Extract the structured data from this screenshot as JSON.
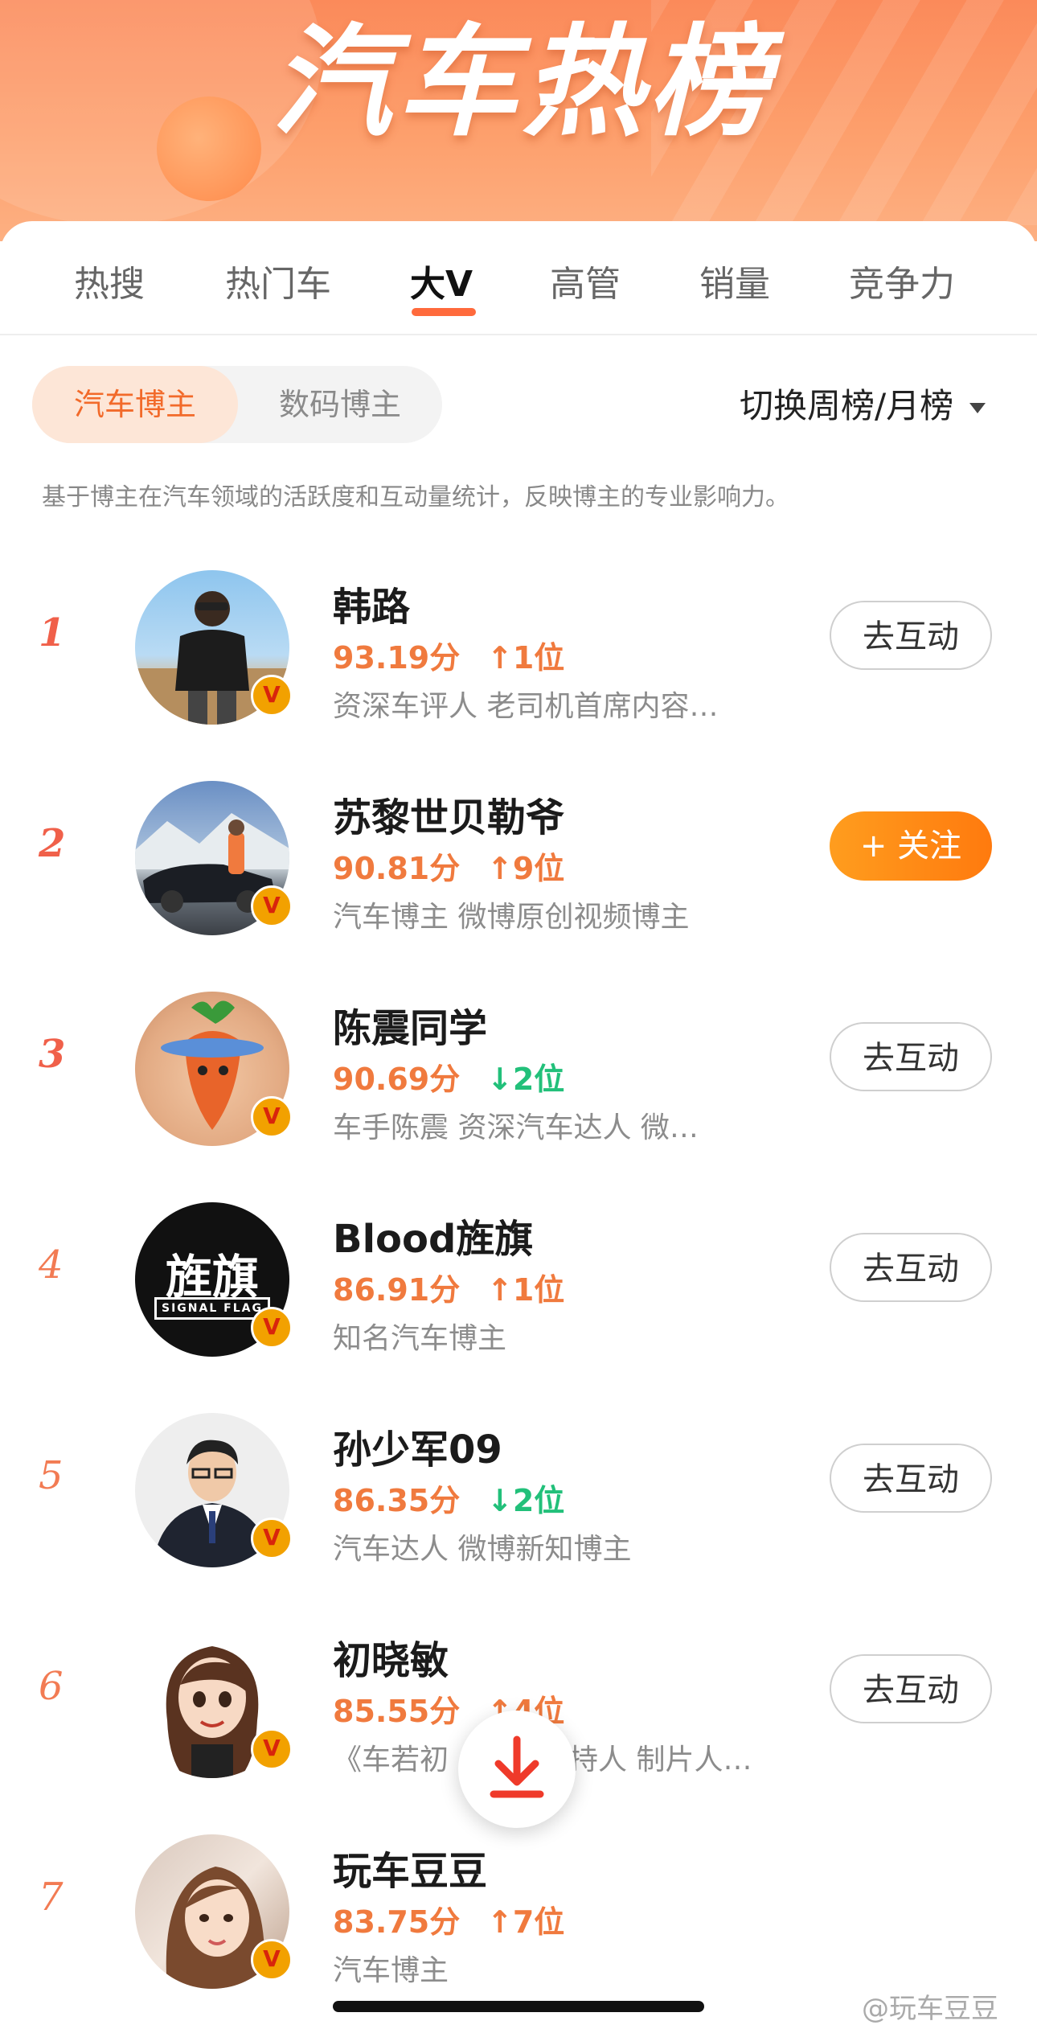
{
  "banner": {
    "title": "汽车热榜"
  },
  "tabs": [
    {
      "label": "热搜"
    },
    {
      "label": "热门车"
    },
    {
      "label": "大V"
    },
    {
      "label": "高管"
    },
    {
      "label": "销量"
    },
    {
      "label": "竞争力"
    }
  ],
  "segment": {
    "active": "汽车博主",
    "inactive": "数码博主"
  },
  "switch_label": "切换周榜/月榜",
  "description": "基于博主在汽车领域的活跃度和互动量统计，反映博主的专业影响力。",
  "rows": [
    {
      "rank": "1",
      "name": "韩路",
      "score": "93.19分",
      "change": "1位",
      "dir": "up",
      "sub": "资深车评人 老司机首席内容…",
      "button": "去互动"
    },
    {
      "rank": "2",
      "name": "苏黎世贝勒爷",
      "score": "90.81分",
      "change": "9位",
      "dir": "up",
      "sub": "汽车博主 微博原创视频博主",
      "button": "+ 关注"
    },
    {
      "rank": "3",
      "name": "陈震同学",
      "score": "90.69分",
      "change": "2位",
      "dir": "down",
      "sub": "车手陈震 资深汽车达人 微…",
      "button": "去互动"
    },
    {
      "rank": "4",
      "name": "Blood旌旗",
      "score": "86.91分",
      "change": "1位",
      "dir": "up",
      "sub": "知名汽车博主",
      "button": "去互动",
      "avatar_text": "旌旗",
      "avatar_sub": "SIGNAL FLAG"
    },
    {
      "rank": "5",
      "name": "孙少军09",
      "score": "86.35分",
      "change": "2位",
      "dir": "down",
      "sub": "汽车达人 微博新知博主",
      "button": "去互动"
    },
    {
      "rank": "6",
      "name": "初晓敏",
      "score": "85.55分",
      "change": "4位",
      "dir": "up",
      "sub": "《车若初",
      "sub_tail": "持人 制片人…",
      "button": "去互动"
    },
    {
      "rank": "7",
      "name": "玩车豆豆",
      "score": "83.75分",
      "change": "7位",
      "dir": "up",
      "sub": "汽车博主"
    }
  ],
  "verified_badge": "V",
  "watermark": "@玩车豆豆",
  "colors": {
    "accent": "#ff6a3c",
    "score": "#f07a3e",
    "down": "#22c07a",
    "follow": "#ff8a14"
  },
  "icons": {
    "up": "arrow-up-icon",
    "down": "arrow-down-icon",
    "fab": "download-icon"
  }
}
